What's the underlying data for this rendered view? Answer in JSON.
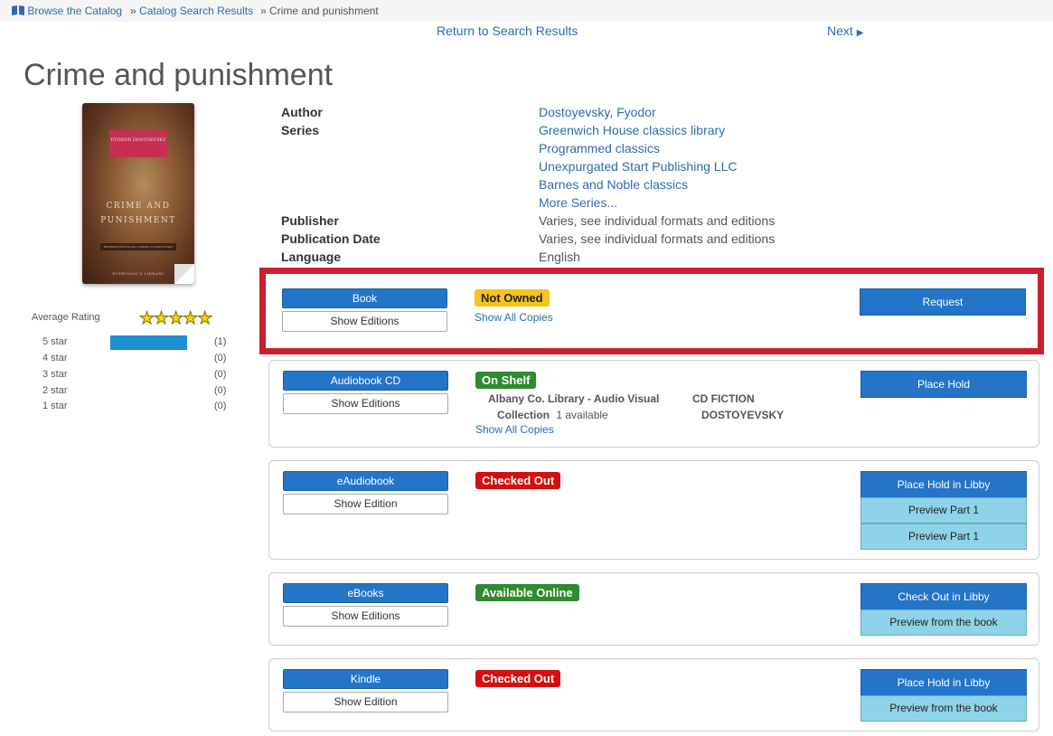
{
  "breadcrumb": {
    "items": [
      {
        "label": "Browse the Catalog"
      },
      {
        "separator": "»",
        "label": "Catalog Search Results"
      },
      {
        "separator": "»",
        "label": "Crime and punishment"
      }
    ]
  },
  "nav": {
    "return_label": "Return to Search Results",
    "next_label": "Next"
  },
  "title": "Crime and punishment",
  "cover": {
    "author_band": "FYODOR DOSTOEVSKY",
    "title_line1": "CRIME AND",
    "title_line2": "PUNISHMENT",
    "translators": "RICHARD PEVEAR and LARISSA VOLOKHONSKY",
    "publisher": "EVERYMAN'S LIBRARY"
  },
  "rating": {
    "label": "Average Rating",
    "stars": "★★★★★",
    "average": 5,
    "histogram": [
      {
        "label": "5 star",
        "count": "(1)",
        "fraction": 1
      },
      {
        "label": "4 star",
        "count": "(0)",
        "fraction": 0
      },
      {
        "label": "3 star",
        "count": "(0)",
        "fraction": 0
      },
      {
        "label": "2 star",
        "count": "(0)",
        "fraction": 0
      },
      {
        "label": "1 star",
        "count": "(0)",
        "fraction": 0
      }
    ]
  },
  "details": {
    "author_label": "Author",
    "author": "Dostoyevsky, Fyodor",
    "series_label": "Series",
    "series": [
      "Greenwich House classics library",
      "Programmed classics",
      "Unexpurgated Start Publishing LLC",
      "Barnes and Noble classics"
    ],
    "more_series": "More Series...",
    "publisher_label": "Publisher",
    "publisher": "Varies, see individual formats and editions",
    "pubdate_label": "Publication Date",
    "pubdate": "Varies, see individual formats and editions",
    "language_label": "Language",
    "language": "English"
  },
  "formats": [
    {
      "name": "Book",
      "editions_label": "Show Editions",
      "status": "Not Owned",
      "copies_label": "Show All Copies",
      "action": "Request"
    },
    {
      "name": "Audiobook CD",
      "editions_label": "Show Editions",
      "status": "On Shelf",
      "location_line1": "Albany Co. Library - Audio Visual",
      "location_line2": "Collection",
      "availability": "1 available",
      "callnumber_line1": "CD FICTION",
      "callnumber_line2": "DOSTOYEVSKY",
      "copies_label": "Show All Copies",
      "action": "Place Hold"
    },
    {
      "name": "eAudiobook",
      "editions_label": "Show Edition",
      "status": "Checked Out",
      "action": "Place Hold in Libby",
      "previews": [
        "Preview Part 1",
        "Preview Part 1"
      ]
    },
    {
      "name": "eBooks",
      "editions_label": "Show Editions",
      "status": "Available Online",
      "action": "Check Out in Libby",
      "previews": [
        "Preview from the book"
      ]
    },
    {
      "name": "Kindle",
      "editions_label": "Show Edition",
      "status": "Checked Out",
      "action": "Place Hold in Libby",
      "previews": [
        "Preview from the book"
      ]
    }
  ],
  "colors": {
    "highlight_border": "#cc1f2e",
    "primary_button": "#2474c8",
    "preview_button": "#8fd3e8",
    "status_not_owned": "#f5c518",
    "status_available": "#2e8b2e",
    "status_checked_out": "#d50f0f",
    "link": "#2e6bb0"
  },
  "icons": {
    "browse": "open-book-icon",
    "next": "caret-right-icon"
  }
}
